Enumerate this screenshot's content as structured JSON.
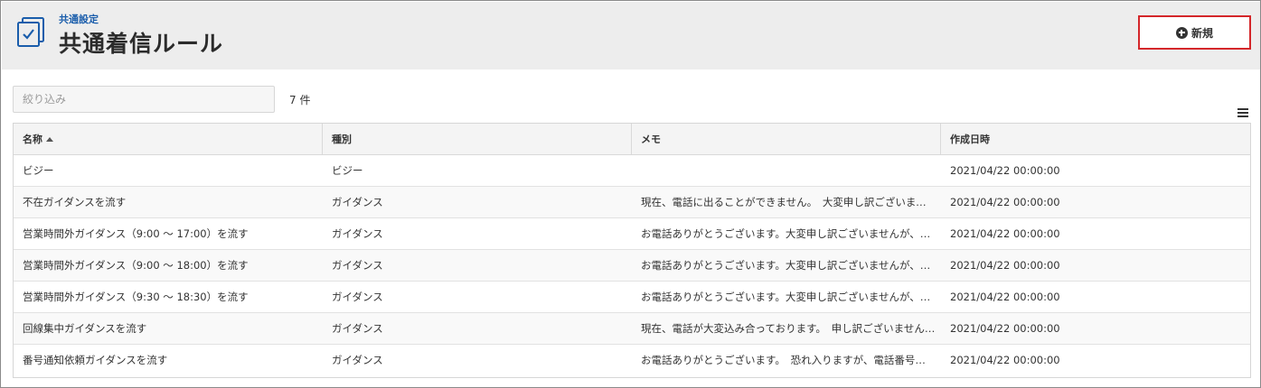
{
  "header": {
    "breadcrumb": "共通設定",
    "title": "共通着信ルール",
    "new_button_label": "新規",
    "icon": "checklist-icon"
  },
  "toolbar": {
    "filter_placeholder": "絞り込み",
    "filter_value": "",
    "count": "7 件"
  },
  "table": {
    "columns": [
      "名称",
      "種別",
      "メモ",
      "作成日時"
    ],
    "sort": {
      "column": "名称",
      "direction": "asc"
    },
    "rows": [
      {
        "name": "ビジー",
        "type": "ビジー",
        "memo": "",
        "created": "2021/04/22 00:00:00"
      },
      {
        "name": "不在ガイダンスを流す",
        "type": "ガイダンス",
        "memo": "現在、電話に出ることができません。　大変申し訳ございませんが、…",
        "created": "2021/04/22 00:00:00"
      },
      {
        "name": "営業時間外ガイダンス（9:00 ～ 17:00）を流す",
        "type": "ガイダンス",
        "memo": "お電話ありがとうございます。大変申し訳ございませんが、…",
        "created": "2021/04/22 00:00:00"
      },
      {
        "name": "営業時間外ガイダンス（9:00 ～ 18:00）を流す",
        "type": "ガイダンス",
        "memo": "お電話ありがとうございます。大変申し訳ございませんが、…",
        "created": "2021/04/22 00:00:00"
      },
      {
        "name": "営業時間外ガイダンス（9:30 ～ 18:30）を流す",
        "type": "ガイダンス",
        "memo": "お電話ありがとうございます。大変申し訳ございませんが、…",
        "created": "2021/04/22 00:00:00"
      },
      {
        "name": "回線集中ガイダンスを流す",
        "type": "ガイダンス",
        "memo": "現在、電話が大変込み合っております。　申し訳ございませんが、…",
        "created": "2021/04/22 00:00:00"
      },
      {
        "name": "番号通知依頼ガイダンスを流す",
        "type": "ガイダンス",
        "memo": "お電話ありがとうございます。　恐れ入りますが、電話番号…",
        "created": "2021/04/22 00:00:00"
      }
    ]
  },
  "colors": {
    "accent": "#1a5dab",
    "new_button_border": "#d4262a",
    "header_bg": "#ededed"
  }
}
